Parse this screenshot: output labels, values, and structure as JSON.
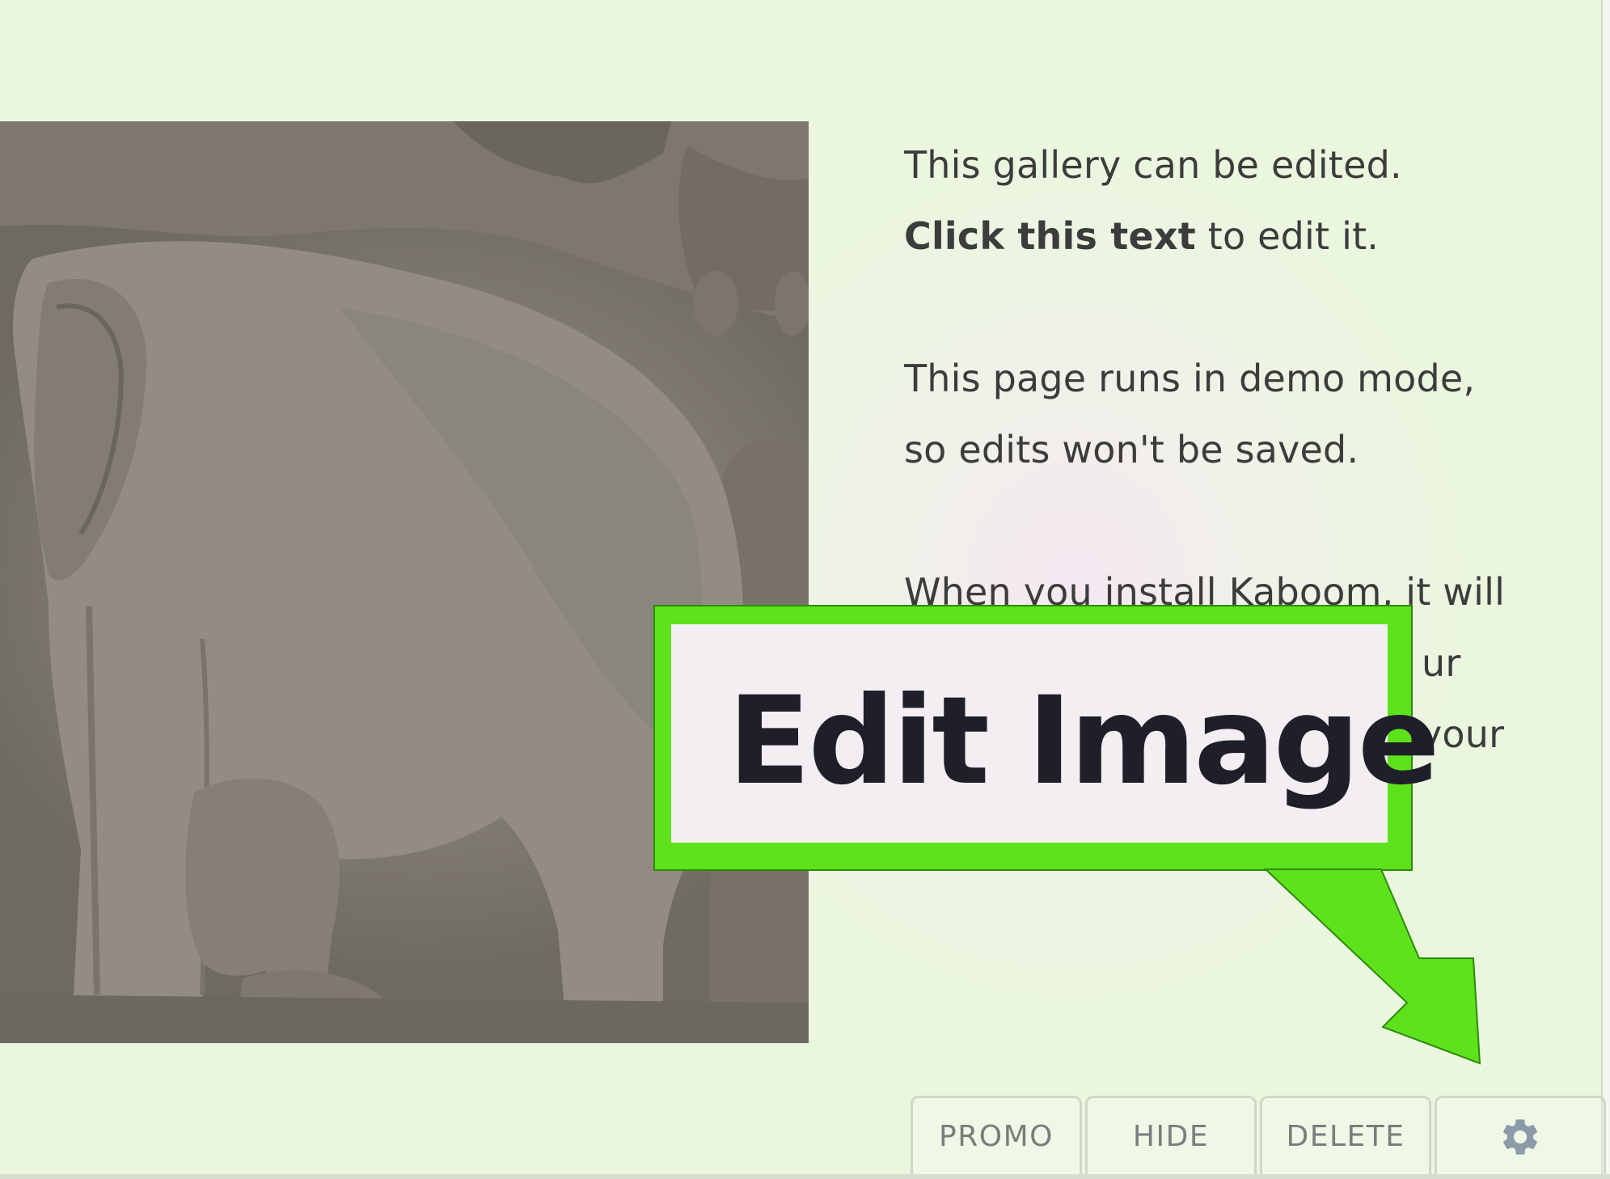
{
  "gallery": {
    "paragraph1_line1": "This gallery can be edited.",
    "paragraph1_bold": "Click this text",
    "paragraph1_rest": " to edit it.",
    "paragraph2_line1": "This page runs in demo mode,",
    "paragraph2_line2": "so edits won't be saved.",
    "paragraph3_line1": "When you install Kaboom, it will",
    "paragraph3_line2_visible": "ur",
    "paragraph3_line3_visible": "your"
  },
  "callout": {
    "label": "Edit Image",
    "color": "#5de21b"
  },
  "toolbar": {
    "promo_label": "PROMO",
    "hide_label": "HIDE",
    "delete_label": "DELETE",
    "settings_icon": "gear-icon"
  },
  "colors": {
    "text": "#3c3c3c",
    "toolbar_text": "#7c7c7c",
    "gear": "#8c9ba8"
  }
}
